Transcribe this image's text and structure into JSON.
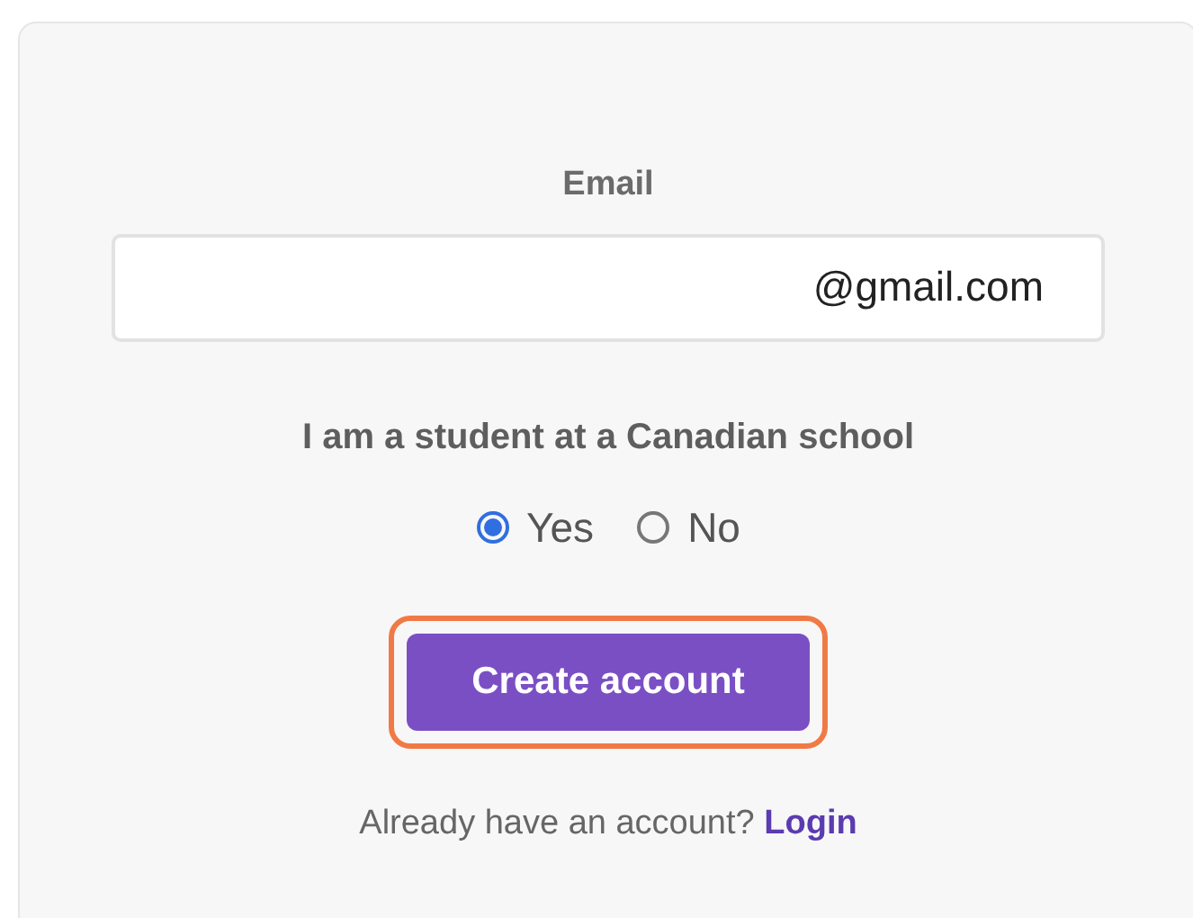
{
  "email": {
    "label": "Email",
    "value": "@gmail.com"
  },
  "student": {
    "label": "I am a student at a Canadian school",
    "options": [
      {
        "label": "Yes",
        "selected": true
      },
      {
        "label": "No",
        "selected": false
      }
    ]
  },
  "submit": {
    "label": "Create account",
    "highlighted": true
  },
  "footer": {
    "text": "Already have an account?",
    "link": "Login"
  }
}
